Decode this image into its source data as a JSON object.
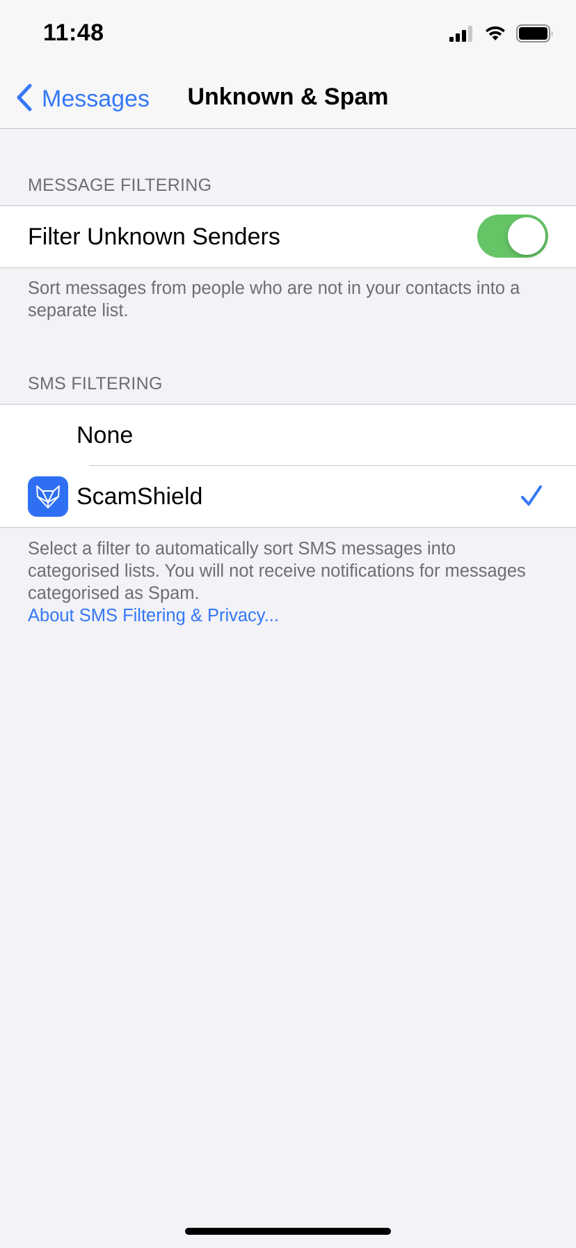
{
  "status_bar": {
    "time": "11:48",
    "icons": [
      "cellular-signal-icon",
      "wifi-icon",
      "battery-icon"
    ]
  },
  "nav": {
    "back_label": "Messages",
    "title": "Unknown & Spam"
  },
  "message_filtering": {
    "header": "MESSAGE FILTERING",
    "filter_unknown_label": "Filter Unknown Senders",
    "filter_unknown_enabled": true,
    "footer": "Sort messages from people who are not in your contacts into a separate list."
  },
  "sms_filtering": {
    "header": "SMS FILTERING",
    "options": [
      {
        "label": "None",
        "selected": false
      },
      {
        "label": "ScamShield",
        "selected": true,
        "icon": "fox-icon"
      }
    ],
    "footer": "Select a filter to automatically sort SMS messages into categorised lists. You will not receive notifications for messages categorised as Spam.",
    "link": "About SMS Filtering & Privacy..."
  },
  "colors": {
    "accent": "#3478f6",
    "toggle_on": "#65c466",
    "app_icon": "#2f6ff3",
    "background": "#f2f2f7"
  }
}
